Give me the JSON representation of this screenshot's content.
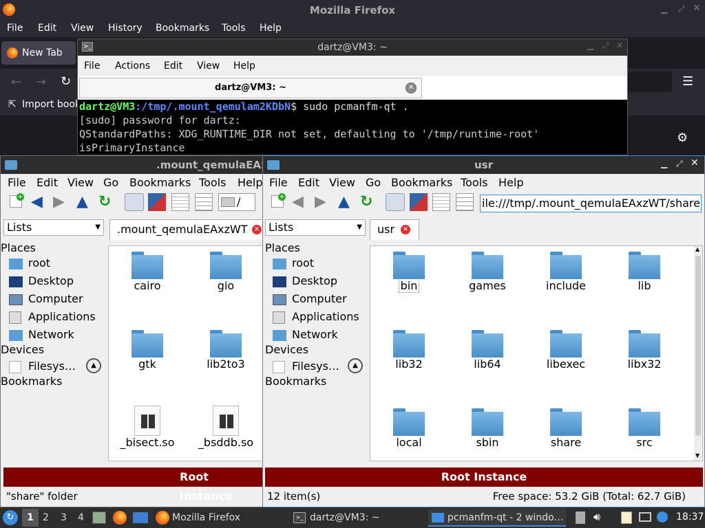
{
  "firefox": {
    "title": "Mozilla Firefox",
    "menu": [
      "File",
      "Edit",
      "View",
      "History",
      "Bookmarks",
      "Tools",
      "Help"
    ],
    "tab_label": "New Tab",
    "import_label": "Import book"
  },
  "terminal": {
    "title": "dartz@VM3: ~",
    "menu": [
      "File",
      "Actions",
      "Edit",
      "View",
      "Help"
    ],
    "tab_label": "dartz@VM3: ~",
    "prompt_user": "dartz@VM3",
    "prompt_path": ":/tmp/.mount_qemulam2KDbN",
    "prompt_cmd": "$ sudo pcmanfm-qt .",
    "lines": [
      "[sudo] password for dartz:",
      "QStandardPaths: XDG_RUNTIME_DIR not set, defaulting to '/tmp/runtime-root'",
      "isPrimaryInstance"
    ]
  },
  "back_window": {
    "title": ".mount_qemulaEAx",
    "menu": [
      "File",
      "Edit",
      "View",
      "Go",
      "Bookmarks",
      "Tools",
      "Help"
    ],
    "path": "/",
    "side_select": "Lists",
    "tab_label": ".mount_qemulaEAxzWT",
    "places_header": "Places",
    "places": [
      "root",
      "Desktop",
      "Computer",
      "Applications",
      "Network"
    ],
    "devices_header": "Devices",
    "device": "Filesys…",
    "bookmarks_header": "Bookmarks",
    "files": [
      "cairo",
      "gio",
      "gtk",
      "lib2to3",
      "_bisect.so",
      "_bsddb.so"
    ],
    "root_banner": "Root Instance",
    "status": "\"share\" folder"
  },
  "front_window": {
    "title": "usr",
    "menu": [
      "File",
      "Edit",
      "View",
      "Go",
      "Bookmarks",
      "Tools",
      "Help"
    ],
    "path": "ile:///tmp/.mount_qemulaEAxzWT/share",
    "side_select": "Lists",
    "tab_label": "usr",
    "places_header": "Places",
    "places": [
      "root",
      "Desktop",
      "Computer",
      "Applications",
      "Network"
    ],
    "devices_header": "Devices",
    "device": "Filesys…",
    "bookmarks_header": "Bookmarks",
    "files": [
      "bin",
      "games",
      "include",
      "lib",
      "lib32",
      "lib64",
      "libexec",
      "libx32",
      "local",
      "sbin",
      "share",
      "src"
    ],
    "root_banner": "Root Instance",
    "item_count": "12 item(s)",
    "free_space": "Free space: 53.2 GiB (Total: 62.7 GiB)"
  },
  "taskbar": {
    "workspaces": [
      "1",
      "2",
      "3",
      "4"
    ],
    "tasks": [
      "Mozilla Firefox",
      "dartz@VM3: ~",
      "pcmanfm-qt - 2 windo…"
    ],
    "clock": "18:37"
  },
  "colors": {
    "root_banner": "#800000",
    "prompt_user": "#5fff5f",
    "prompt_path": "#5f87ff",
    "folder_blue": "#5a9fd4"
  }
}
